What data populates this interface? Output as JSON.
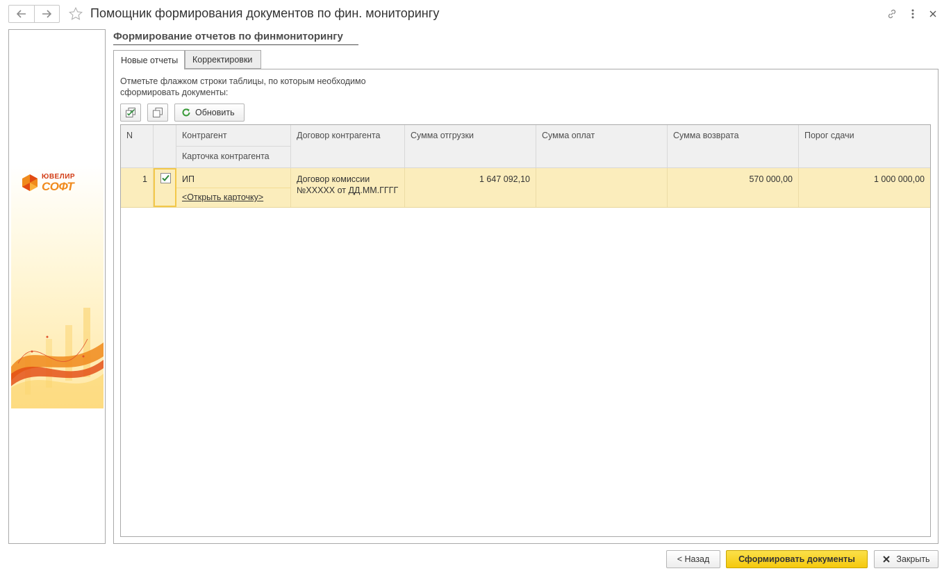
{
  "window": {
    "title": "Помощник формирования документов по фин. мониторингу",
    "icons": [
      "back-arrow-icon",
      "forward-arrow-icon",
      "star-icon",
      "link-icon",
      "more-vertical-icon",
      "close-icon"
    ]
  },
  "brand": {
    "line1": "ЮВЕЛИР",
    "line2": "СОФТ"
  },
  "main": {
    "header": "Формирование отчетов по финмониторингу",
    "tabs": [
      {
        "label": "Новые отчеты",
        "active": true
      },
      {
        "label": "Корректировки",
        "active": false
      }
    ],
    "hint": "Отметьте флажком строки таблицы, по которым необходимо сформировать документы:",
    "toolbar": {
      "check_all_icon": "check-all-icon",
      "uncheck_all_icon": "uncheck-all-icon",
      "refresh_label": "Обновить"
    }
  },
  "table": {
    "columns": {
      "n": "N",
      "counterparty": "Контрагент",
      "counterparty_card": "Карточка контрагента",
      "contract": "Договор контрагента",
      "shipment_sum": "Сумма отгрузки",
      "payment_sum": "Сумма оплат",
      "return_sum": "Сумма возврата",
      "threshold": "Порог сдачи"
    },
    "rows": [
      {
        "n": "1",
        "checked": true,
        "counterparty": "ИП",
        "card_link": "<Открыть карточку>",
        "contract": "Договор комиссии №XXXXX от ДД.ММ.ГГГГ",
        "shipment_sum": "1 647 092,10",
        "payment_sum": "",
        "return_sum": "570 000,00",
        "threshold": "1 000 000,00"
      }
    ]
  },
  "footer": {
    "back_label": "< Назад",
    "generate_label": "Сформировать документы",
    "close_label": "Закрыть"
  },
  "colors": {
    "accent_yellow": "#f5c90d",
    "selected_row": "#fbedbc",
    "check_green": "#2e8b3a",
    "refresh_green": "#3a9a3a"
  }
}
